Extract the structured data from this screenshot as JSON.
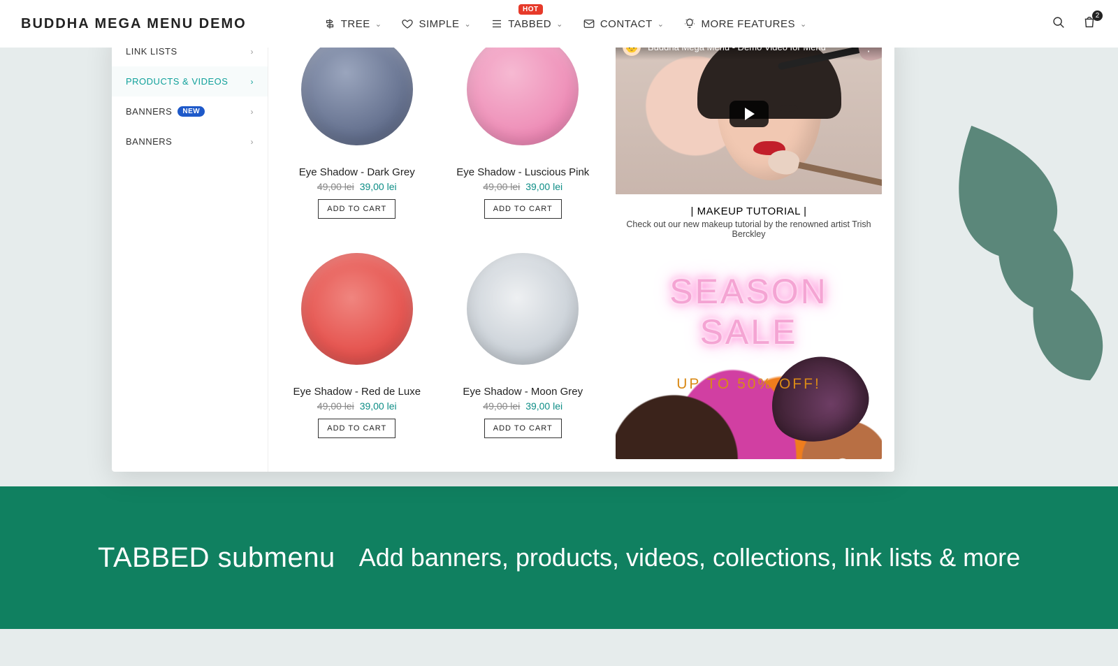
{
  "colors": {
    "accent_teal": "#11a19b",
    "sale_price": "#0d8d86",
    "hot": "#e63a2a",
    "new_badge": "#1e59c9",
    "footer": "#108060",
    "promo_pink": "#f4a4d3",
    "promo_orange": "#d98a17"
  },
  "header": {
    "logo": "BUDDHA MEGA MENU DEMO",
    "nav": {
      "tree": {
        "label": "TREE"
      },
      "simple": {
        "label": "SIMPLE"
      },
      "tabbed": {
        "label": "TABBED",
        "badge": "HOT"
      },
      "contact": {
        "label": "CONTACT"
      },
      "more": {
        "label": "MORE FEATURES"
      }
    },
    "cart_count": "2"
  },
  "sidebar": {
    "items": [
      {
        "label": "LINK LISTS"
      },
      {
        "label": "PRODUCTS & VIDEOS"
      },
      {
        "label": "BANNERS",
        "badge": "NEW"
      },
      {
        "label": "BANNERS"
      }
    ]
  },
  "products": {
    "add_to_cart": "ADD TO CART",
    "items": [
      {
        "title": "Eye Shadow - Dark Grey",
        "old": "49,00 lei",
        "new": "39,00 lei"
      },
      {
        "title": "Eye Shadow - Luscious Pink",
        "old": "49,00 lei",
        "new": "39,00 lei"
      },
      {
        "title": "Eye Shadow - Red de Luxe",
        "old": "49,00 lei",
        "new": "39,00 lei"
      },
      {
        "title": "Eye Shadow - Moon Grey",
        "old": "49,00 lei",
        "new": "39,00 lei"
      }
    ]
  },
  "video": {
    "yt_title": "Buddha Mega Menu - Demo Video for Menu",
    "avatar_emoji": "👶",
    "caption_title": "| MAKEUP TUTORIAL |",
    "caption_body": "Check out our new makeup tutorial by the renowned artist Trish Berckley"
  },
  "promo": {
    "title": "SEASON SALE",
    "subtitle": "UP TO 50% OFF!"
  },
  "footer": {
    "heading": "TABBED submenu",
    "body": "Add banners, products, videos, collections, link lists & more"
  }
}
